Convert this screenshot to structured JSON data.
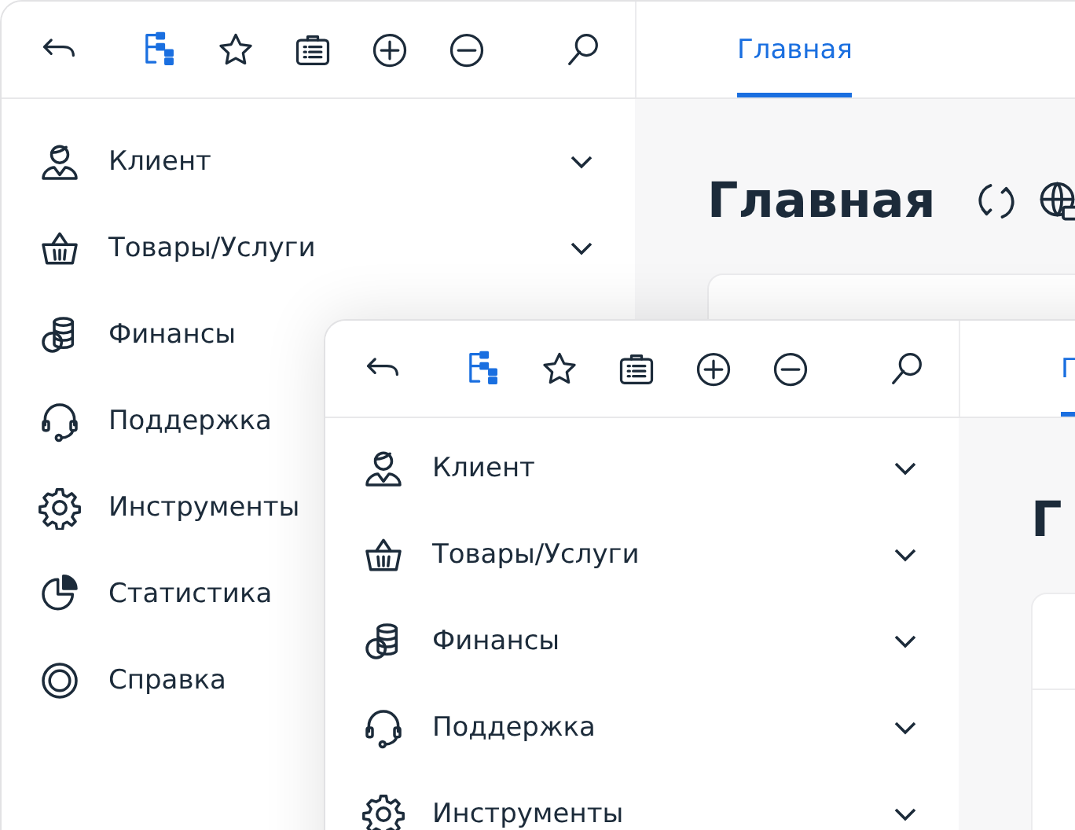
{
  "windows": [
    {
      "toolbar": [
        {
          "kind": "back",
          "selected": false
        },
        {
          "kind": "tree",
          "selected": true
        },
        {
          "kind": "star",
          "selected": false
        },
        {
          "kind": "briefcase",
          "selected": false
        },
        {
          "kind": "add",
          "selected": false
        },
        {
          "kind": "remove",
          "selected": false
        },
        {
          "kind": "search",
          "selected": false
        }
      ],
      "tabs": [
        {
          "label": "Главная",
          "selected": true
        }
      ],
      "sidebar": {
        "items": [
          {
            "kind": "client",
            "label": "Клиент",
            "expandable": true
          },
          {
            "kind": "basket",
            "label": "Товары/Услуги",
            "expandable": true
          },
          {
            "kind": "coins",
            "label": "Финансы",
            "expandable": false
          },
          {
            "kind": "headset",
            "label": "Поддержка",
            "expandable": false
          },
          {
            "kind": "gear",
            "label": "Инструменты",
            "expandable": false
          },
          {
            "kind": "pie",
            "label": "Статистика",
            "expandable": false
          },
          {
            "kind": "lifebuoy",
            "label": "Справка",
            "expandable": false
          }
        ]
      },
      "page": {
        "title": "Главная",
        "actions": [
          {
            "kind": "refresh"
          },
          {
            "kind": "globe"
          }
        ]
      }
    },
    {
      "toolbar": [
        {
          "kind": "back",
          "selected": false
        },
        {
          "kind": "tree",
          "selected": true
        },
        {
          "kind": "star",
          "selected": false
        },
        {
          "kind": "briefcase",
          "selected": false
        },
        {
          "kind": "add",
          "selected": false
        },
        {
          "kind": "remove",
          "selected": false
        },
        {
          "kind": "search",
          "selected": false
        }
      ],
      "tabs": [
        {
          "label": "Г",
          "selected": true
        }
      ],
      "sidebar": {
        "items": [
          {
            "kind": "client",
            "label": "Клиент",
            "expandable": true
          },
          {
            "kind": "basket",
            "label": "Товары/Услуги",
            "expandable": true
          },
          {
            "kind": "coins",
            "label": "Финансы",
            "expandable": true
          },
          {
            "kind": "headset",
            "label": "Поддержка",
            "expandable": true
          },
          {
            "kind": "gear",
            "label": "Инструменты",
            "expandable": true
          }
        ]
      },
      "page": {
        "title": "Г"
      }
    }
  ]
}
